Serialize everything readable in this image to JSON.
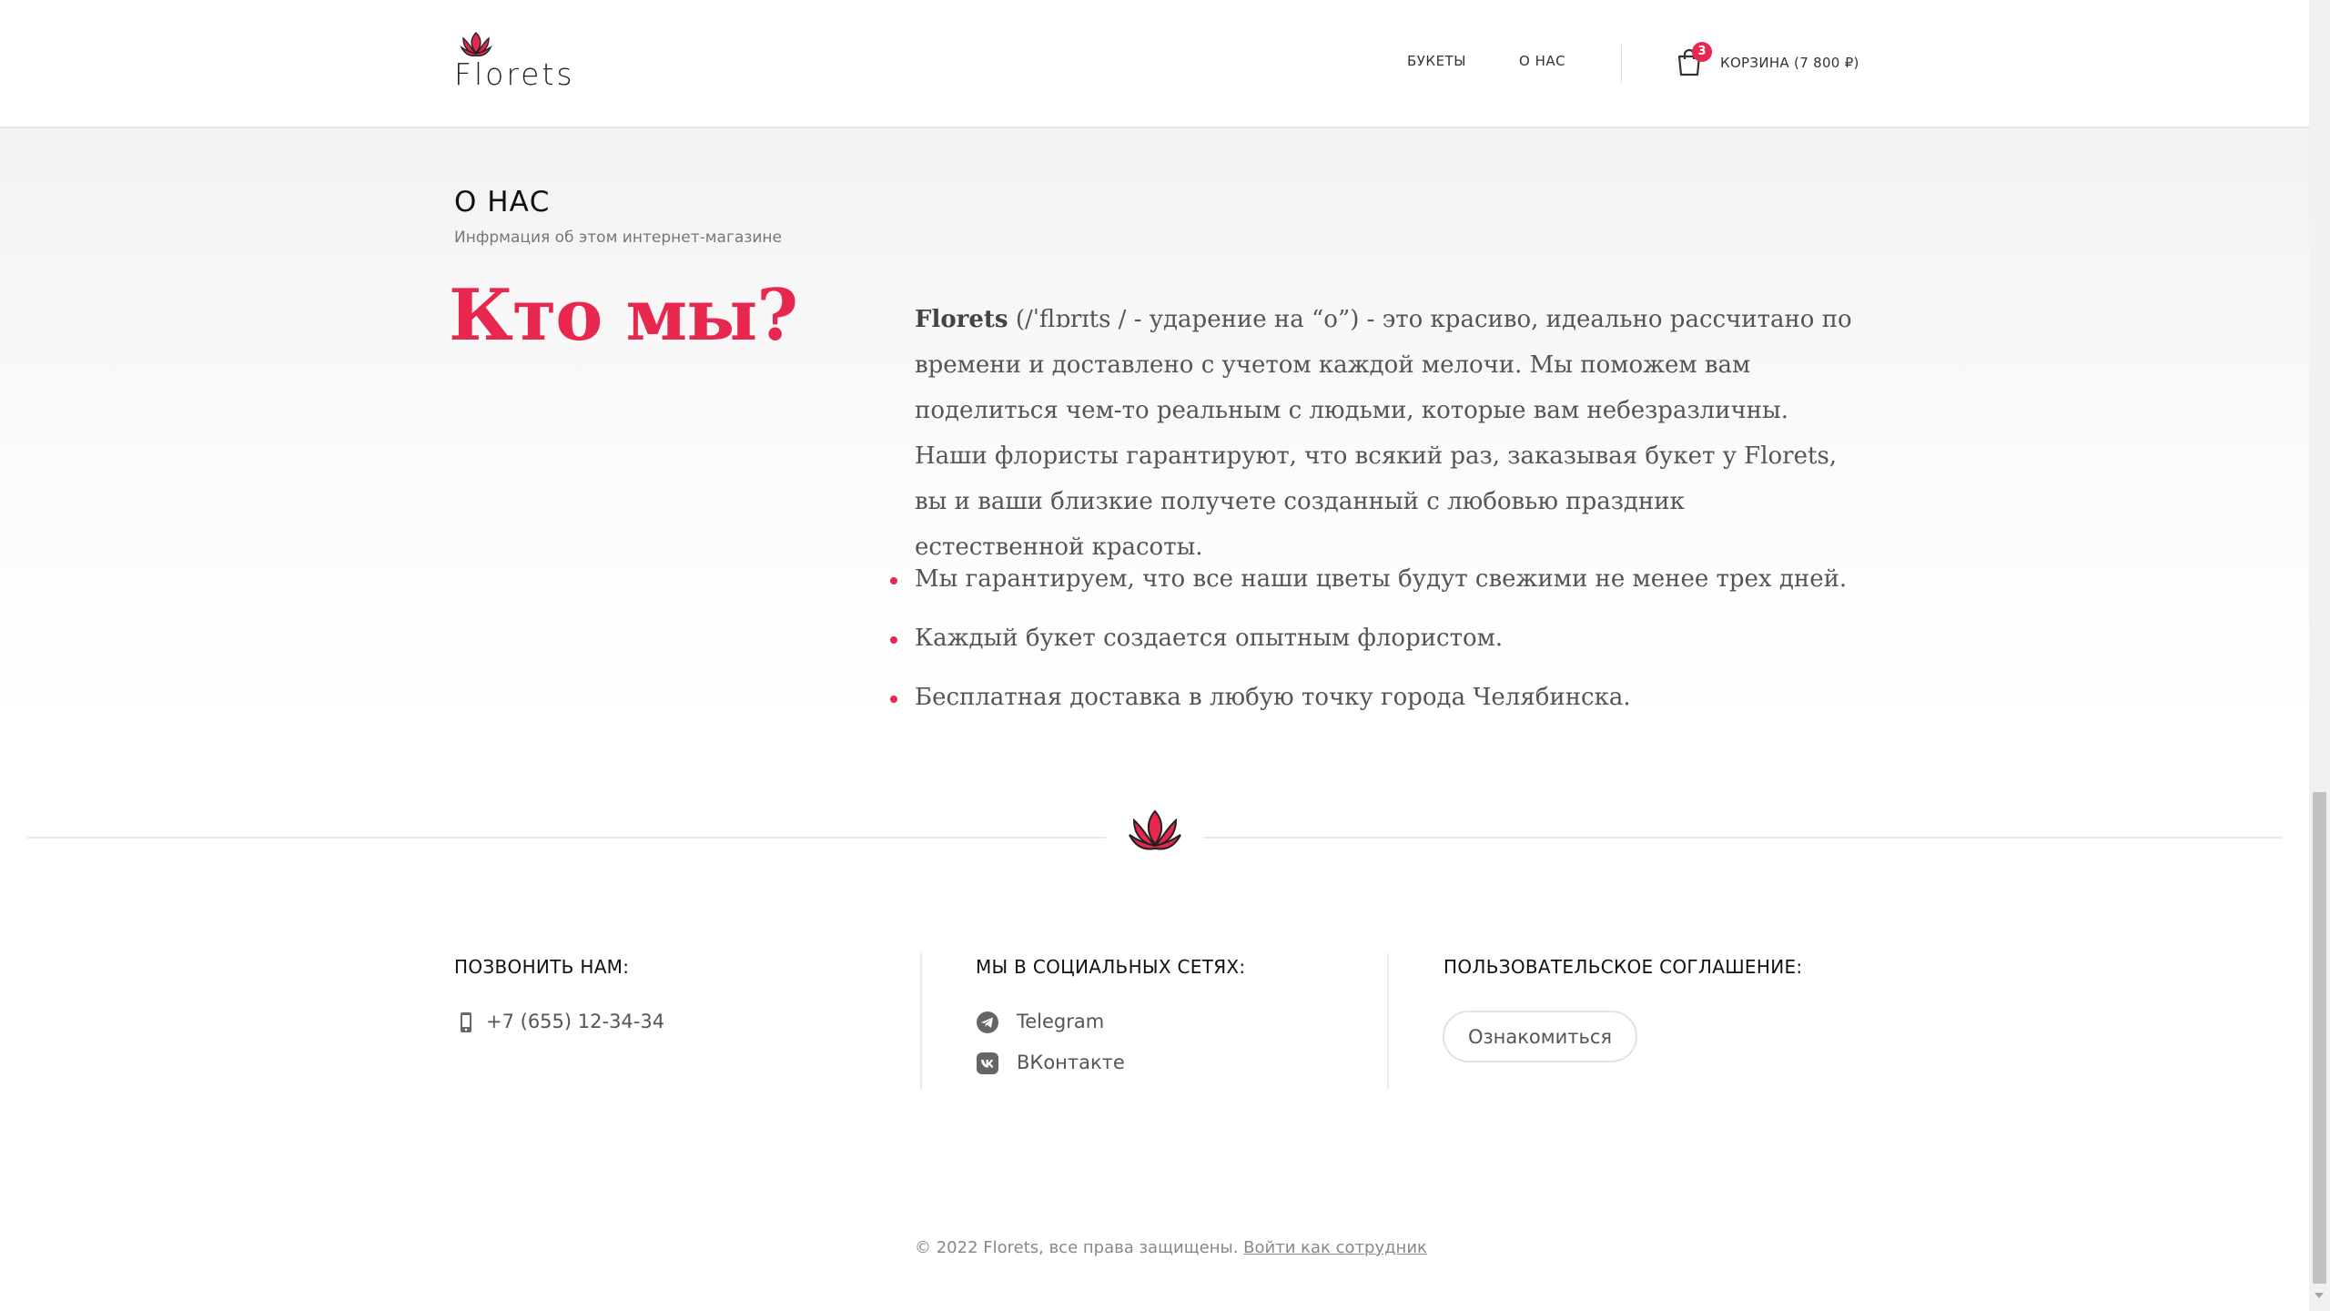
{
  "header": {
    "logo_text": "Florets",
    "nav": [
      {
        "label": "БУКЕТЫ"
      },
      {
        "label": "О НАС"
      }
    ],
    "cart": {
      "badge": "3",
      "label": "КОРЗИНА (7 800 ₽)"
    }
  },
  "about": {
    "title": "О НАС",
    "subtitle": "Инфрмация об этом интернет-магазине",
    "heading": "Кто мы?",
    "brand": "Florets",
    "description": " (/ˈflɒrɪts / - ударение на “o”) - это красиво, идеально рассчитано по времени и доставлено с учетом каждой мелочи. Мы поможем вам поделиться чем-то реальным с людьми, которые вам небезразличны. Наши флористы гарантируют, что всякий раз, заказывая букет у Florets, вы и ваши близкие получете созданный с любовью праздник естественной красоты.",
    "benefits": [
      "Мы гарантируем, что все наши цветы будут свежими не менее трех дней.",
      "Каждый букет создается опытным флористом.",
      "Бесплатная доставка в любую точку города Челябинска."
    ]
  },
  "footer": {
    "phone": {
      "title": "ПОЗВОНИТЬ НАМ:",
      "number": "+7 (655) 12-34-34",
      "icon": "phone-icon"
    },
    "social": {
      "title": "МЫ В СОЦИАЛЬНЫХ СЕТЯХ:",
      "telegram": "Telegram",
      "vk": "ВКонтакте"
    },
    "terms": {
      "title": "ПОЛЬЗОВАТЕЛЬСКОЕ СОГЛАШЕНИЕ:",
      "button": "Ознакомиться"
    },
    "copyright": "© 2022 Florets, все права защищены. ",
    "employee_login": "Войти как сотрудник"
  },
  "colors": {
    "accent": "#e8274f",
    "text": "#555555"
  }
}
